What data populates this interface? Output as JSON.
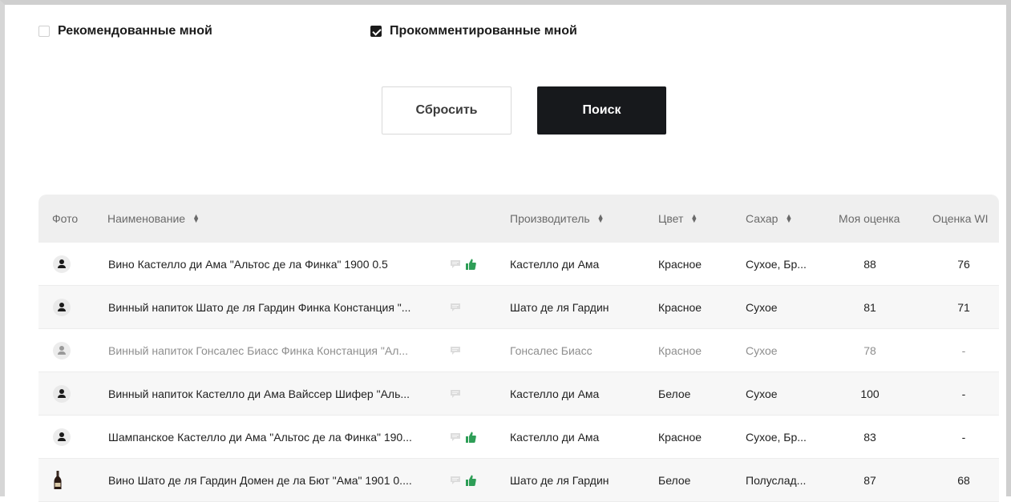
{
  "filters": {
    "recommended_label": "Рекомендованные мной",
    "recommended_checked": false,
    "commented_label": "Прокомментированные мной",
    "commented_checked": true
  },
  "buttons": {
    "reset_label": "Сбросить",
    "search_label": "Поиск"
  },
  "table": {
    "headers": {
      "photo": "Фото",
      "name": "Наименование",
      "producer": "Производитель",
      "color": "Цвет",
      "sugar": "Сахар",
      "my_rating": "Моя оценка",
      "wi_rating": "Оценка WI"
    },
    "rows": [
      {
        "name": "Вино Кастелло ди Ама \"Альтос де ла Финка\" 1900 0.5",
        "producer": "Кастелло ди Ама",
        "color": "Красное",
        "sugar": "Сухое, Бр...",
        "my_rating": "88",
        "wi_rating": "76",
        "thumb": true,
        "photo": "avatar-icon"
      },
      {
        "name": "Винный напиток Шато де ля Гардин Финка Констанция \"...",
        "producer": "Шато де ля Гардин",
        "color": "Красное",
        "sugar": "Сухое",
        "my_rating": "81",
        "wi_rating": "71",
        "thumb": false,
        "photo": "avatar-icon"
      },
      {
        "name": "Винный напиток Гонсалес Биасс Финка Констанция \"Ал...",
        "producer": "Гонсалес Биасс",
        "color": "Красное",
        "sugar": "Сухое",
        "my_rating": "78",
        "wi_rating": "-",
        "thumb": false,
        "photo": "avatar-icon"
      },
      {
        "name": "Винный напиток Кастелло ди Ама Вайссер Шифер \"Аль...",
        "producer": "Кастелло ди Ама",
        "color": "Белое",
        "sugar": "Сухое",
        "my_rating": "100",
        "wi_rating": "-",
        "thumb": false,
        "photo": "avatar-icon"
      },
      {
        "name": "Шампанское Кастелло ди Ама \"Альтос де ла Финка\" 190...",
        "producer": "Кастелло ди Ама",
        "color": "Красное",
        "sugar": "Сухое, Бр...",
        "my_rating": "83",
        "wi_rating": "-",
        "thumb": true,
        "photo": "avatar-icon"
      },
      {
        "name": "Вино Шато де ля Гардин Домен де ла Бют \"Ама\" 1901 0....",
        "producer": "Шато де ля Гардин",
        "color": "Белое",
        "sugar": "Полуслад...",
        "my_rating": "87",
        "wi_rating": "68",
        "thumb": true,
        "photo": "wine-bottle-icon"
      }
    ]
  },
  "colors": {
    "thumb": "#2e9e57",
    "dark_button": "#17191c",
    "header_bg": "#efefef"
  }
}
